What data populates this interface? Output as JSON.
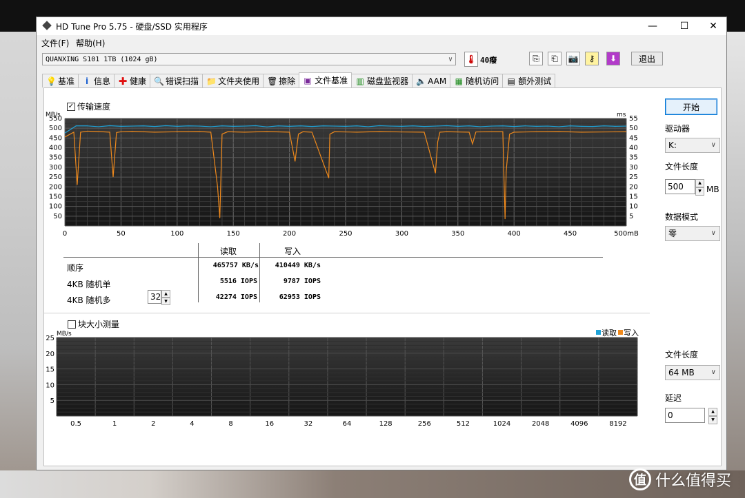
{
  "window": {
    "title": "HD Tune Pro 5.75 - 硬盘/SSD 实用程序",
    "controls": {
      "minimize": "—",
      "maximize": "☐",
      "close": "✕"
    }
  },
  "menu": {
    "file": "文件(F)",
    "help": "帮助(H)"
  },
  "toolbar": {
    "drive": "QUANXING S101 1TB (1024 gB)",
    "temperature": "40癈",
    "exit_label": "退出"
  },
  "tabs": [
    {
      "label": "基准",
      "icon": "bulb-icon"
    },
    {
      "label": "信息",
      "icon": "info-icon"
    },
    {
      "label": "健康",
      "icon": "health-cross-icon"
    },
    {
      "label": "错误扫描",
      "icon": "magnifier-icon"
    },
    {
      "label": "文件夹使用",
      "icon": "folder-icon"
    },
    {
      "label": "擦除",
      "icon": "trash-icon"
    },
    {
      "label": "文件基准",
      "icon": "file-benchmark-icon"
    },
    {
      "label": "磁盘监视器",
      "icon": "monitor-chart-icon"
    },
    {
      "label": "AAM",
      "icon": "speaker-icon"
    },
    {
      "label": "随机访问",
      "icon": "random-access-icon"
    },
    {
      "label": "额外测试",
      "icon": "extra-tests-icon"
    }
  ],
  "active_tab": "文件基准",
  "transfer": {
    "checkbox_label": "传输速度",
    "checked": true
  },
  "chart_data": [
    {
      "type": "line",
      "ylabel_left": "MB/s",
      "ylabel_right": "ms",
      "x_ticks": [
        "0",
        "50",
        "100",
        "150",
        "200",
        "250",
        "300",
        "350",
        "400",
        "450",
        "500mB"
      ],
      "y_ticks_left": [
        "550",
        "500",
        "450",
        "400",
        "350",
        "300",
        "250",
        "200",
        "150",
        "100",
        "50"
      ],
      "y_ticks_right": [
        "55",
        "50",
        "45",
        "40",
        "35",
        "30",
        "25",
        "20",
        "15",
        "10",
        "5"
      ],
      "xlim": [
        0,
        500
      ],
      "ylim": [
        0,
        550
      ],
      "series": [
        {
          "name": "读取",
          "color": "#1fa3d8",
          "x": [
            0,
            10,
            20,
            30,
            40,
            50,
            60,
            70,
            80,
            90,
            100,
            110,
            120,
            130,
            140,
            150,
            160,
            170,
            180,
            190,
            200,
            210,
            220,
            230,
            240,
            250,
            260,
            270,
            280,
            290,
            300,
            310,
            320,
            330,
            340,
            350,
            360,
            370,
            380,
            390,
            400,
            410,
            420,
            430,
            440,
            450,
            460,
            470,
            480,
            490,
            500
          ],
          "values": [
            475,
            512,
            512,
            508,
            513,
            510,
            511,
            512,
            509,
            513,
            510,
            512,
            511,
            508,
            512,
            510,
            511,
            513,
            507,
            512,
            510,
            512,
            509,
            512,
            511,
            510,
            512,
            508,
            513,
            511,
            510,
            512,
            509,
            511,
            513,
            510,
            512,
            508,
            511,
            512,
            509,
            512,
            510,
            511,
            508,
            512,
            510,
            509,
            512,
            510,
            511
          ]
        },
        {
          "name": "写入",
          "color": "#f08a1c",
          "x": [
            0,
            8,
            11,
            14,
            20,
            30,
            40,
            43,
            46,
            50,
            60,
            80,
            100,
            120,
            130,
            136,
            138,
            140,
            145,
            160,
            180,
            200,
            205,
            208,
            212,
            220,
            235,
            236,
            240,
            260,
            280,
            300,
            320,
            330,
            332,
            334,
            340,
            360,
            363,
            366,
            380,
            390,
            392,
            393,
            396,
            400,
            420,
            440,
            460,
            480,
            500
          ],
          "values": [
            455,
            480,
            210,
            480,
            485,
            483,
            480,
            250,
            478,
            482,
            484,
            480,
            482,
            483,
            480,
            200,
            40,
            470,
            482,
            480,
            483,
            480,
            330,
            470,
            482,
            480,
            245,
            470,
            482,
            480,
            483,
            481,
            480,
            270,
            430,
            480,
            482,
            480,
            420,
            481,
            482,
            482,
            35,
            280,
            470,
            480,
            482,
            483,
            480,
            481,
            482
          ]
        }
      ]
    },
    {
      "type": "bar",
      "ylabel": "MB/s",
      "categories": [
        "0.5",
        "1",
        "2",
        "4",
        "8",
        "16",
        "32",
        "64",
        "128",
        "256",
        "512",
        "1024",
        "2048",
        "4096",
        "8192"
      ],
      "ylim": [
        0,
        25
      ],
      "y_ticks": [
        "25",
        "20",
        "15",
        "10",
        "5"
      ],
      "series": [
        {
          "name": "读取",
          "color": "#1fa3d8",
          "values": []
        },
        {
          "name": "写入",
          "color": "#f08a1c",
          "values": []
        }
      ],
      "legend_position": "top-right"
    }
  ],
  "results": {
    "header_read": "读取",
    "header_write": "写入",
    "rows": [
      {
        "label": "顺序",
        "read": "465757 KB/s",
        "write": "410449 KB/s"
      },
      {
        "label": "4KB 随机单",
        "read": "5516 IOPS",
        "write": "9787 IOPS"
      },
      {
        "label": "4KB 随机多",
        "read": "42274 IOPS",
        "write": "62953 IOPS"
      }
    ],
    "queue_depth": "32"
  },
  "block": {
    "checkbox_label": "块大小测量",
    "checked": false
  },
  "right": {
    "start_label": "开始",
    "drive_label": "驱动器",
    "drive_value": "K:",
    "file_length_label": "文件长度",
    "file_length_value": "500",
    "file_length_unit": "MB",
    "data_mode_label": "数据模式",
    "data_mode_value": "零",
    "file_length2_label": "文件长度",
    "file_length2_value": "64 MB",
    "delay_label": "延迟",
    "delay_value": "0"
  },
  "watermark": {
    "icon_char": "值",
    "text": "什么值得买"
  }
}
